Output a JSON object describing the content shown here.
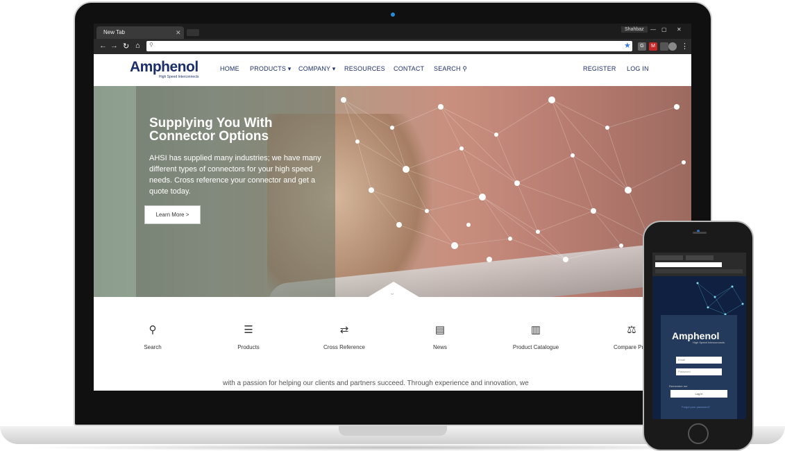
{
  "browser": {
    "tab_title": "New Tab",
    "tab_close": "✕",
    "profile_name": "Shahbaz",
    "window_controls": [
      "—",
      "▢",
      "✕"
    ],
    "nav_icons": [
      "arrow-left-icon",
      "arrow-right-icon",
      "reload-icon",
      "home-icon"
    ],
    "address_value": "",
    "bookmark_icon": "star-icon"
  },
  "site": {
    "logo": "Amphenol",
    "logo_subtitle": "High Speed Interconnects",
    "nav": [
      {
        "label": "HOME"
      },
      {
        "label": "PRODUCTS ▾"
      },
      {
        "label": "COMPANY ▾"
      },
      {
        "label": "RESOURCES"
      },
      {
        "label": "CONTACT"
      },
      {
        "label": "SEARCH ⚲"
      }
    ],
    "register": "REGISTER",
    "login": "LOG IN"
  },
  "hero": {
    "title": "Supplying You With Connector Options",
    "text": "AHSI has supplied many industries; we have many different types of connectors for your high speed needs. Cross reference your connector and get a quote today.",
    "button": "Learn More >"
  },
  "quick_links": [
    {
      "icon": "⚲",
      "icon_name": "search-icon",
      "label": "Search"
    },
    {
      "icon": "☰",
      "icon_name": "list-icon",
      "label": "Products"
    },
    {
      "icon": "⇄",
      "icon_name": "shuffle-icon",
      "label": "Cross Reference"
    },
    {
      "icon": "▤",
      "icon_name": "document-icon",
      "label": "News"
    },
    {
      "icon": "▥",
      "icon_name": "book-icon",
      "label": "Product Catalogue"
    },
    {
      "icon": "⚖",
      "icon_name": "scale-icon",
      "label": "Compare Prod"
    }
  ],
  "tagline": "with a passion for helping our clients and partners succeed. Through experience and innovation, we",
  "phone": {
    "logo": "Amphenol",
    "logo_subtitle": "High Speed Interconnects",
    "email_placeholder": "Email",
    "password_placeholder": "Password",
    "remember": "Remember me",
    "login_button": "Log in",
    "forgot_link": "Forgot your password?"
  },
  "colors": {
    "brand_navy": "#1c2e6b",
    "accent_blue": "#2a8cd6"
  }
}
